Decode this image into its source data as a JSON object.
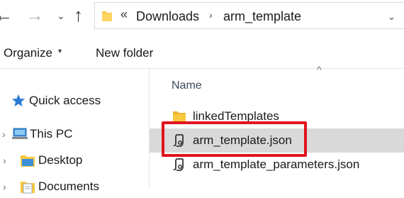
{
  "nav": {
    "back_glyph": "←",
    "forward_glyph": "→",
    "recent_glyph": "⌄",
    "up_glyph": "↑"
  },
  "address": {
    "overflow": "«",
    "separator": "›",
    "crumbs": [
      "Downloads",
      "arm_template"
    ],
    "dropdown_glyph": "⌄"
  },
  "toolbar": {
    "organize_label": "Organize",
    "organize_caret": "▾",
    "new_folder_label": "New folder"
  },
  "sidebar": {
    "items": [
      {
        "label": "Quick access",
        "icon": "star-icon"
      },
      {
        "label": "This PC",
        "icon": "computer-icon",
        "expander": "›"
      },
      {
        "label": "Desktop",
        "icon": "folder-icon",
        "expander": "›"
      },
      {
        "label": "Documents",
        "icon": "documents-icon",
        "expander": "›"
      }
    ]
  },
  "filelist": {
    "sort_glyph": "^",
    "column_name": "Name",
    "rows": [
      {
        "name": "linkedTemplates",
        "icon": "folder-icon"
      },
      {
        "name": "arm_template.json",
        "icon": "json-file-icon",
        "selected": true
      },
      {
        "name": "arm_template_parameters.json",
        "icon": "json-file-icon"
      }
    ]
  },
  "colors": {
    "folder": "#f8c93e",
    "selection": "#d9d9d9",
    "highlight": "#e0141e",
    "accent": "#2b7bd3"
  }
}
